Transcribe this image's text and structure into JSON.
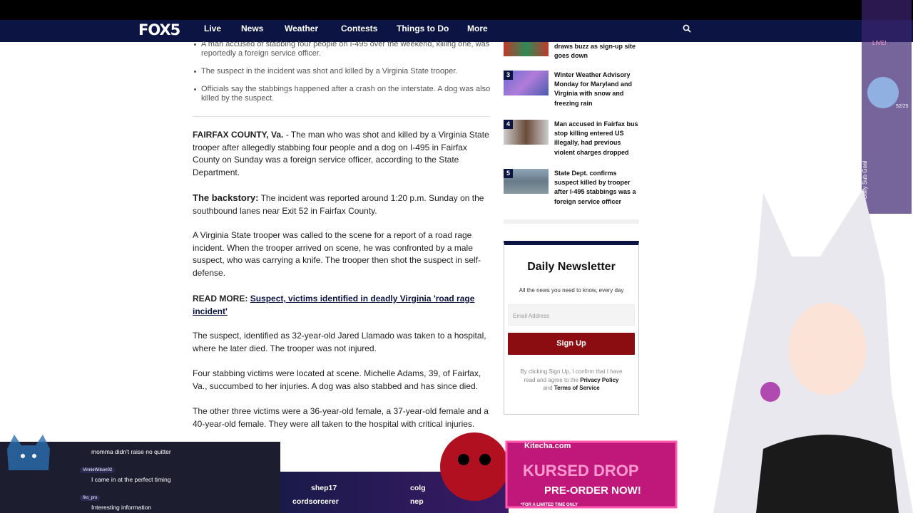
{
  "nav": {
    "logo": "FOX5",
    "items": [
      "Live",
      "News",
      "Weather",
      "Contests",
      "Things to Do",
      "More"
    ]
  },
  "article": {
    "bullets": [
      "A man accused of stabbing four people on I-495 over the weekend, killing one, was reportedly a foreign service officer.",
      "The suspect in the incident was shot and killed by a Virginia State trooper.",
      "Officials say the stabbings happened after a crash on the interstate. A dog was also killed by the suspect."
    ],
    "dateline": "FAIRFAX COUNTY, Va.",
    "p1": " - The man who was shot and killed by a Virginia State trooper after allegedly stabbing four people and a dog on I-495 in Fairfax County on Sunday was a foreign service officer, according to the State Department.",
    "backstory_label": "The backstory:",
    "p2": " The incident was reported around 1:20 p.m. Sunday on the southbound lanes near Exit 52 in Fairfax County.",
    "p3": "A Virginia State trooper was called to the scene for a report of a road rage incident. When the trooper arrived on scene, he was confronted by a male suspect, who was carrying a knife. The trooper then shot the suspect in self-defense.",
    "readmore_label": "READ MORE:",
    "readmore_link": "Suspect, victims identified in deadly Virginia 'road rage incident'",
    "p4": "The suspect, identified as 32-year-old Jared Llamado was taken to a hospital, where he later died. The trooper was not injured.",
    "p5": "Four stabbing victims were located at scene. Michelle Adams, 39, of Fairfax, Va., succumbed to her injuries. A dog was also stabbed and has since died.",
    "p6": "The other three victims were a 36-year-old female, a 37-year-old female and a 40-year-old female. They were all taken to the hospital with critical injuries."
  },
  "trending": [
    {
      "num": "",
      "title": "draws buzz as sign-up site goes down"
    },
    {
      "num": "3",
      "title": "Winter Weather Advisory Monday for Maryland and Virginia with snow and freezing rain"
    },
    {
      "num": "4",
      "title": "Man accused in Fairfax bus stop killing entered US illegally, had previous violent charges dropped"
    },
    {
      "num": "5",
      "title": "State Dept. confirms suspect killed by trooper after I-495 stabbings was a foreign service officer"
    }
  ],
  "newsletter": {
    "title": "Daily Newsletter",
    "subtitle": "All the news you need to know, every day",
    "email_placeholder": "Email Address",
    "signup_label": "Sign Up",
    "fine1": "By clicking Sign Up, I confirm that I have read and agree to the",
    "privacy": "Privacy Policy",
    "and": "and",
    "terms": "Terms of Service"
  },
  "chat": {
    "messages": [
      {
        "user": "",
        "text": "momma didn't raise no quitter"
      },
      {
        "user": "VinnieWilson02",
        "text": "I came in at the perfect timing"
      },
      {
        "user": "firo_pro",
        "text": "Interesting information"
      }
    ]
  },
  "ticker": {
    "names": [
      "shep17",
      "cordsorcerer",
      "colg",
      "nep"
    ]
  },
  "promo": {
    "brand": "Kitecha.com",
    "line1": "KURSED DROP",
    "line2": "PRE-ORDER NOW!",
    "fine": "*FOR A LIMITED TIME ONLY"
  },
  "overlay": {
    "live": "LIVE!",
    "counter": "52/25",
    "goal": "Daily Sub Goal"
  }
}
